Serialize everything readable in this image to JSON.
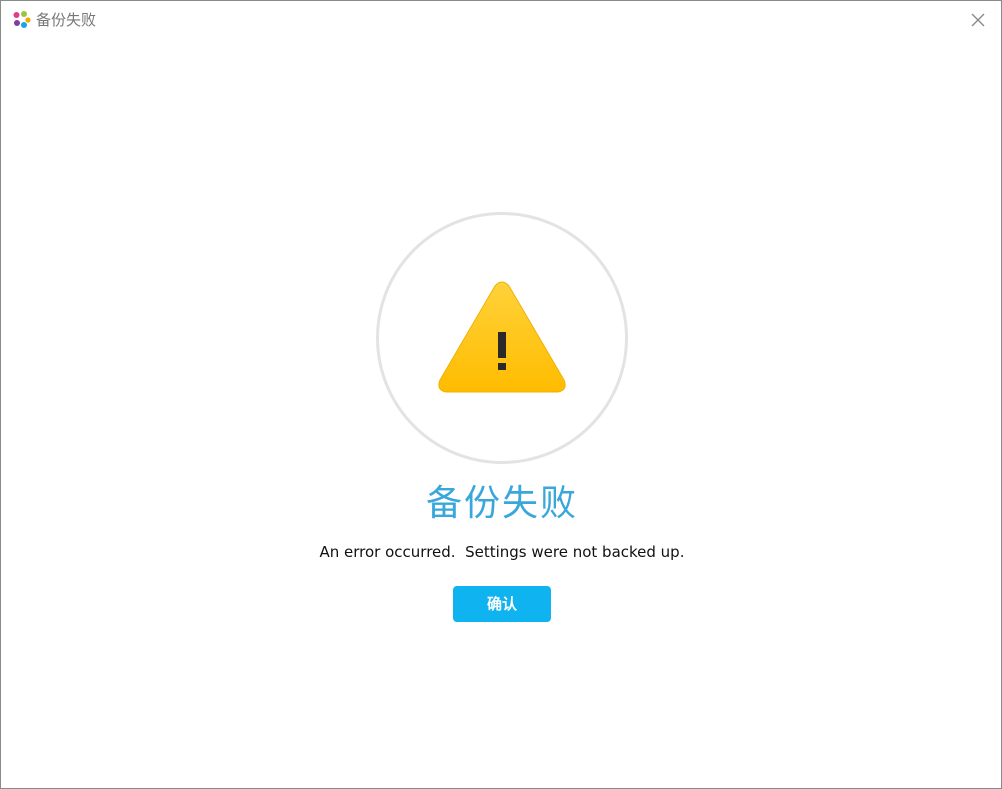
{
  "window": {
    "title": "备份失败",
    "app_icon": "app-logo-icon",
    "close_icon": "close-icon"
  },
  "dialog": {
    "status_icon": "warning-icon",
    "heading": "备份失败",
    "message": "An error occurred.  Settings were not backed up.",
    "confirm_label": "确认"
  },
  "colors": {
    "heading": "#3aa7dc",
    "button_bg": "#0eb3ef",
    "button_text": "#ffffff",
    "warning_fill": "#ffc20e",
    "ring": "#e3e3e3"
  }
}
